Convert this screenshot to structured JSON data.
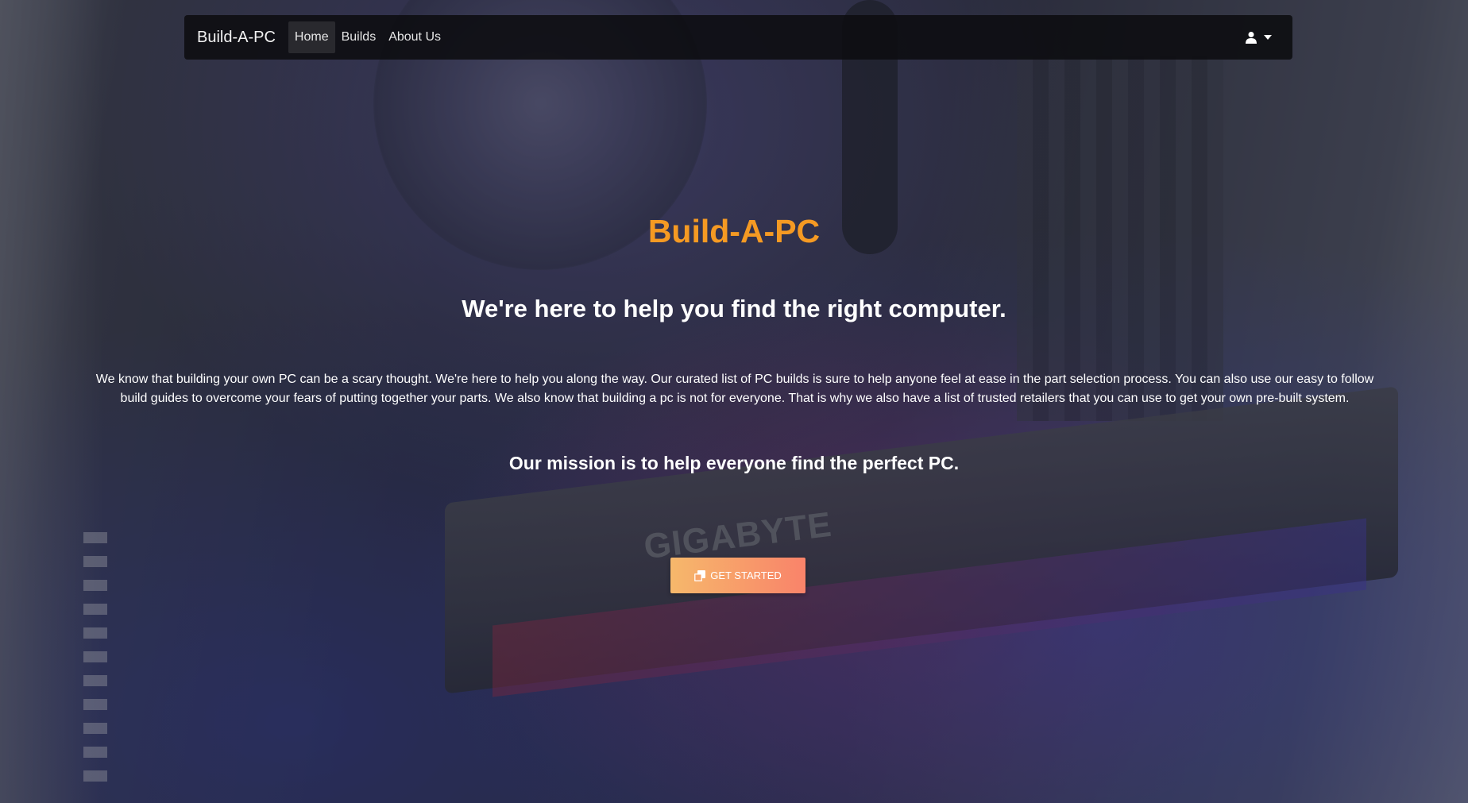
{
  "navbar": {
    "brand": "Build-A-PC",
    "links": [
      {
        "label": "Home",
        "active": true
      },
      {
        "label": "Builds",
        "active": false
      },
      {
        "label": "About Us",
        "active": false
      }
    ],
    "user_menu_icon": "user-icon"
  },
  "hero": {
    "background_watermark": "GIGABYTE",
    "title": "Build-A-PC",
    "title_color": "#f59a23",
    "tagline": "We're here to help you find the right computer.",
    "description": "We know that building your own PC can be a scary thought. We're here to help you along the way. Our curated list of PC builds is sure to help anyone feel at ease in the part selection process. You can also use our easy to follow build guides to overcome your fears of putting together your parts. We also know that building a pc is not for everyone. That is why we also have a list of trusted retailers that you can use to get your own pre-built system.",
    "mission": "Our mission is to help everyone find the perfect PC.",
    "cta": {
      "label": "GET STARTED",
      "icon": "copy-icon",
      "gradient_start": "#f6b86b",
      "gradient_end": "#f9836a"
    }
  }
}
